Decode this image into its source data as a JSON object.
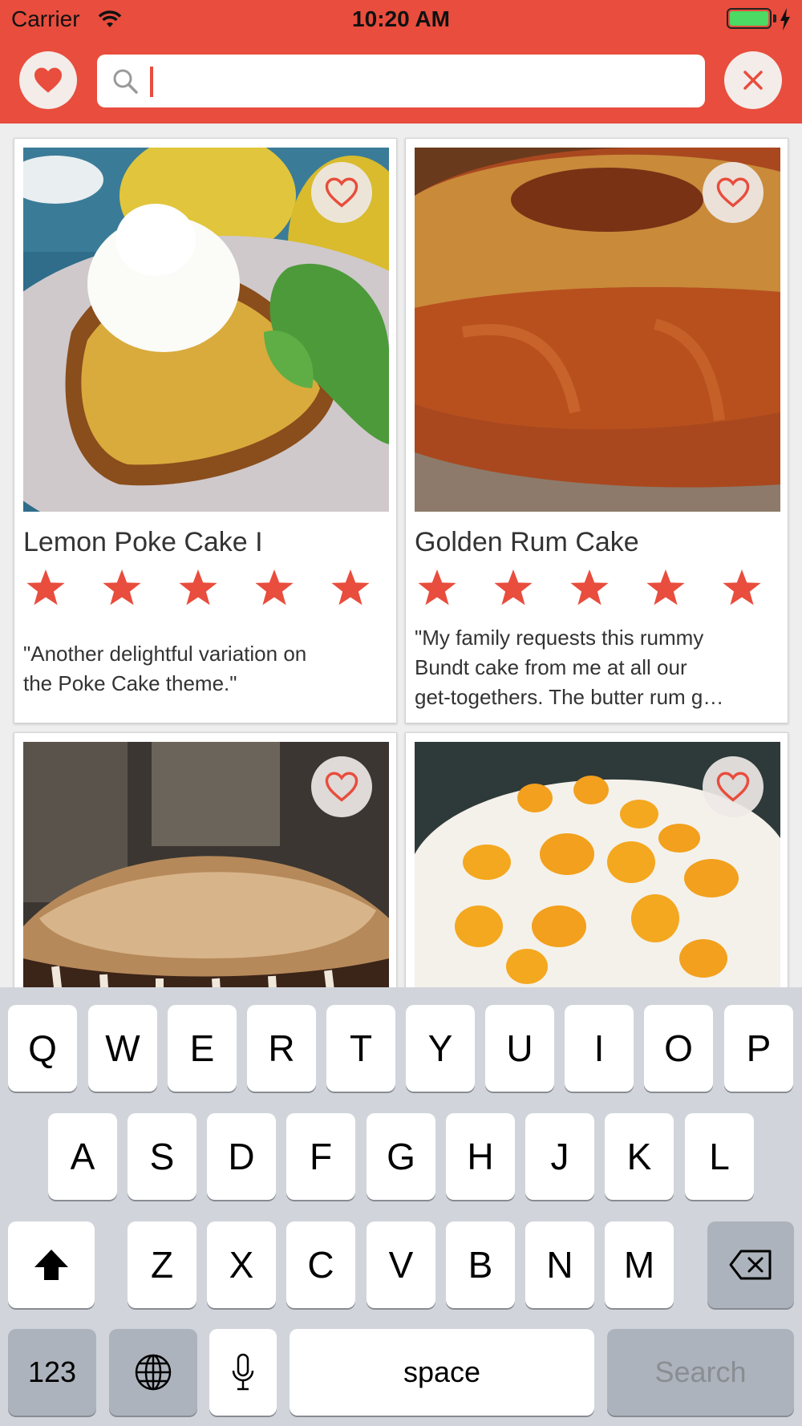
{
  "status_bar": {
    "carrier": "Carrier",
    "time": "10:20 AM",
    "battery_percent": 100
  },
  "header": {
    "search": {
      "value": "",
      "placeholder": ""
    },
    "accent_color": "#e84d3d"
  },
  "recipes": [
    {
      "title": "Lemon Poke Cake I",
      "rating": 5,
      "description_lines": [
        "\"Another delightful variation on",
        "the Poke Cake theme.\""
      ],
      "favorited": false
    },
    {
      "title": "Golden Rum Cake",
      "rating": 5,
      "description_lines": [
        "\"My family requests this rummy",
        "Bundt cake from me at all our",
        "get-togethers. The butter rum g…"
      ],
      "favorited": false
    },
    {
      "title": "",
      "rating": 0,
      "description_lines": [],
      "favorited": false
    },
    {
      "title": "",
      "rating": 0,
      "description_lines": [],
      "favorited": false
    }
  ],
  "keyboard": {
    "row1": [
      "Q",
      "W",
      "E",
      "R",
      "T",
      "Y",
      "U",
      "I",
      "O",
      "P"
    ],
    "row2": [
      "A",
      "S",
      "D",
      "F",
      "G",
      "H",
      "J",
      "K",
      "L"
    ],
    "row3": [
      "Z",
      "X",
      "C",
      "V",
      "B",
      "N",
      "M"
    ],
    "numbers_label": "123",
    "space_label": "space",
    "return_label": "Search"
  }
}
